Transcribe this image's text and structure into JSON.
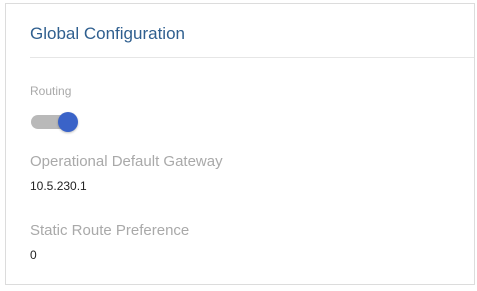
{
  "panel": {
    "title": "Global Configuration"
  },
  "routing": {
    "label": "Routing",
    "enabled": true
  },
  "default_gateway": {
    "label": "Operational Default Gateway",
    "value": "10.5.230.1"
  },
  "static_route_preference": {
    "label": "Static Route Preference",
    "value": "0"
  },
  "colors": {
    "title": "#2f5f8f",
    "label": "#a9a9a9",
    "toggle_track": "#b9b9b9",
    "toggle_knob": "#3a63c8"
  }
}
